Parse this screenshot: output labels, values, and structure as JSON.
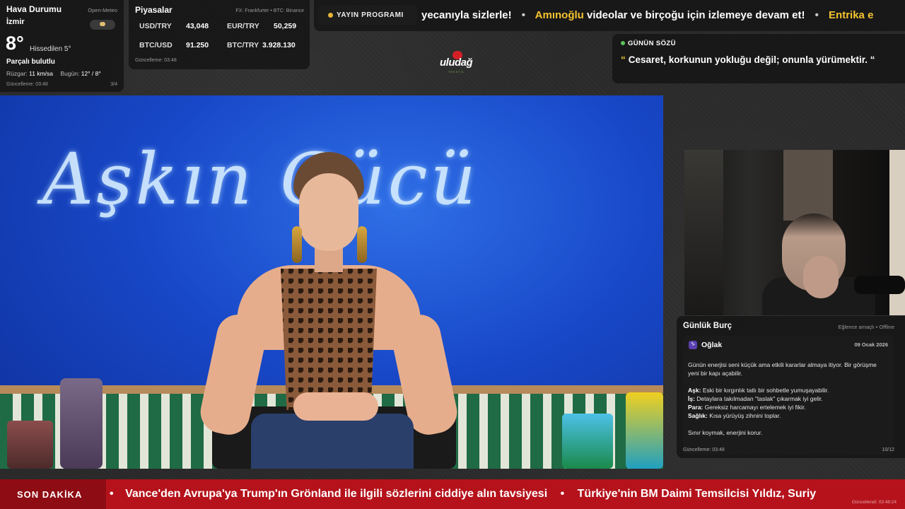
{
  "weather": {
    "title": "Hava Durumu",
    "source": "Open-Meteo",
    "city": "İzmir",
    "temperature": "8°",
    "feels_like": "Hissedilen 5°",
    "condition": "Parçalı bulutlu",
    "wind_label": "Rüzgar:",
    "wind_value": "11 km/sa",
    "today_label": "Bugün:",
    "today_value": "12° / 8°",
    "updated": "Güncelleme: 03:48",
    "page": "3/4",
    "icon": "partly-cloudy-icon"
  },
  "markets": {
    "title": "Piyasalar",
    "source": "FX: Frankfurter • BTC: Binance",
    "rates": [
      {
        "pair": "USD/TRY",
        "value": "43,048"
      },
      {
        "pair": "EUR/TRY",
        "value": "50,259"
      },
      {
        "pair": "BTC/USD",
        "value": "91.250"
      },
      {
        "pair": "BTC/TRY",
        "value": "3.928.130"
      }
    ],
    "updated": "Güncelleme: 03:48"
  },
  "top_ticker": {
    "schedule_label": "YAYIN PROGRAMI",
    "segment1": "yecanıyla sizlerle!",
    "highlight": "Amınoğlu",
    "segment2": "videolar ve birçoğu için izlemeye devam et!",
    "highlight2": "Entrika e"
  },
  "logo": {
    "text": "uludağ",
    "subtext": "TEKSTİL"
  },
  "quote": {
    "title": "GÜNÜN SÖZÜ",
    "mark": "“",
    "text": "Cesaret, korkunun yokluğu değil; onunla yürümektir. “"
  },
  "video": {
    "show_title": "Aşkın Gücü"
  },
  "horoscope": {
    "title": "Günlük Burç",
    "source": "Eğlence amaçlı • Offline",
    "sign_badge": "♑",
    "sign": "Oğlak",
    "date": "09 Ocak 2026",
    "intro": "Günün enerjisi seni küçük ama etkili kararlar almaya itiyor. Bir görüşme yeni bir kapı açabilir.",
    "love_label": "Aşk:",
    "love": "Eski bir kırgınlık tatlı bir sohbetle yumuşayabilir.",
    "work_label": "İş:",
    "work": "Detaylara takılmadan \"taslak\" çıkarmak iyi gelir.",
    "money_label": "Para:",
    "money": "Gereksiz harcamayı ertelemek iyi fikir.",
    "health_label": "Sağlık:",
    "health": "Kısa yürüyüş zihnini toplar.",
    "closing": "Sınır koymak, enerjini korur.",
    "updated": "Güncelleme: 03:48",
    "page": "10/12"
  },
  "breaking": {
    "label": "SON DAKİKA",
    "headline1": "Vance'den Avrupa'ya Trump'ın Grönland ile ilgili sözlerini ciddiye alın tavsiyesi",
    "headline2": "Türkiye'nin BM Daimi Temsilcisi Yıldız, Suriy",
    "updated": "Güncellendi: 03:48:24"
  },
  "colors": {
    "accent_yellow": "#f4c430",
    "breaking_red": "#b5121b",
    "live_green": "#5cc25c"
  }
}
